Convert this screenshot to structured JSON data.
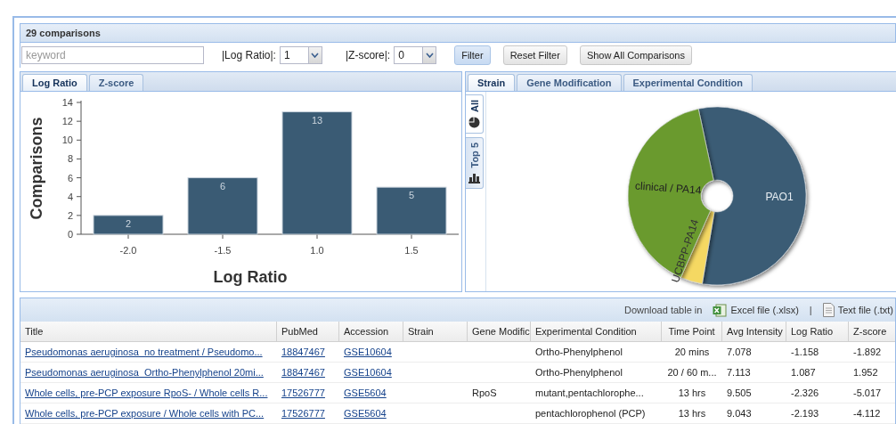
{
  "header": {
    "count": "29 comparisons"
  },
  "filters": {
    "keyword_placeholder": "keyword",
    "log_ratio_label": "|Log Ratio|:",
    "log_ratio_value": "1",
    "zscore_label": "|Z-score|:",
    "zscore_value": "0",
    "buttons": [
      {
        "label": "Filter",
        "selected": true
      },
      {
        "label": "Reset Filter",
        "selected": false
      },
      {
        "label": "Show All Comparisons",
        "selected": false
      }
    ]
  },
  "left_panel": {
    "tabs": [
      {
        "label": "Log Ratio",
        "selected": true
      },
      {
        "label": "Z-score",
        "selected": false
      }
    ],
    "chart_data": {
      "type": "bar",
      "xlabel": "Log Ratio",
      "ylabel": "Comparisons",
      "categories": [
        "-2.0",
        "-1.5",
        "1.0",
        "1.5"
      ],
      "values": [
        2,
        6,
        13,
        5
      ],
      "ylim": [
        0,
        14
      ],
      "yticks": [
        0,
        2,
        4,
        6,
        8,
        10,
        12,
        14
      ],
      "data_labels": true
    }
  },
  "right_panel": {
    "tabs": [
      {
        "label": "Strain",
        "selected": true
      },
      {
        "label": "Gene Modification",
        "selected": false
      },
      {
        "label": "Experimental Condition",
        "selected": false
      }
    ],
    "side_tabs": [
      {
        "label": "All",
        "kind": "pie",
        "selected": true
      },
      {
        "label": "Top 5",
        "kind": "bar",
        "selected": false
      }
    ],
    "slices": [
      {
        "label": "PAO1",
        "color": "#3a5b74"
      },
      {
        "label": "UCBPP-PA14",
        "color": "#f5d862"
      },
      {
        "label": "clinical / PA14",
        "color": "#6b9a2e"
      }
    ]
  },
  "table": {
    "download_label": "Download table in",
    "downloads": [
      {
        "label": "Excel file (.xlsx)",
        "kind": "excel"
      },
      {
        "label": "Text file (.txt)",
        "kind": "text"
      }
    ],
    "separator": "|",
    "columns": [
      "Title",
      "PubMed",
      "Accession",
      "Strain",
      "Gene Modific",
      "Experimental Condition",
      "Time Point",
      "Avg Intensity",
      "Log Ratio",
      "Z-score"
    ],
    "rows": [
      [
        "Pseudomonas aeruginosa_no treatment / Pseudomo...",
        "18847467",
        "GSE10604",
        "",
        "",
        "Ortho-Phenylphenol",
        "20 mins",
        "7.078",
        "-1.158",
        "-1.892"
      ],
      [
        "Pseudomonas aeruginosa_Ortho-Phenylphenol 20mi...",
        "18847467",
        "GSE10604",
        "",
        "",
        "Ortho-Phenylphenol",
        "20 / 60 m...",
        "7.113",
        "1.087",
        "1.952"
      ],
      [
        "Whole cells, pre-PCP exposure RpoS- / Whole cells R...",
        "17526777",
        "GSE5604",
        "",
        "RpoS",
        "mutant,pentachlorophe...",
        "13 hrs",
        "9.505",
        "-2.326",
        "-5.017"
      ],
      [
        "Whole cells, pre-PCP exposure / Whole cells with PC...",
        "17526777",
        "GSE5604",
        "",
        "",
        "pentachlorophenol (PCP)",
        "13 hrs",
        "9.043",
        "-2.193",
        "-4.112"
      ]
    ]
  }
}
